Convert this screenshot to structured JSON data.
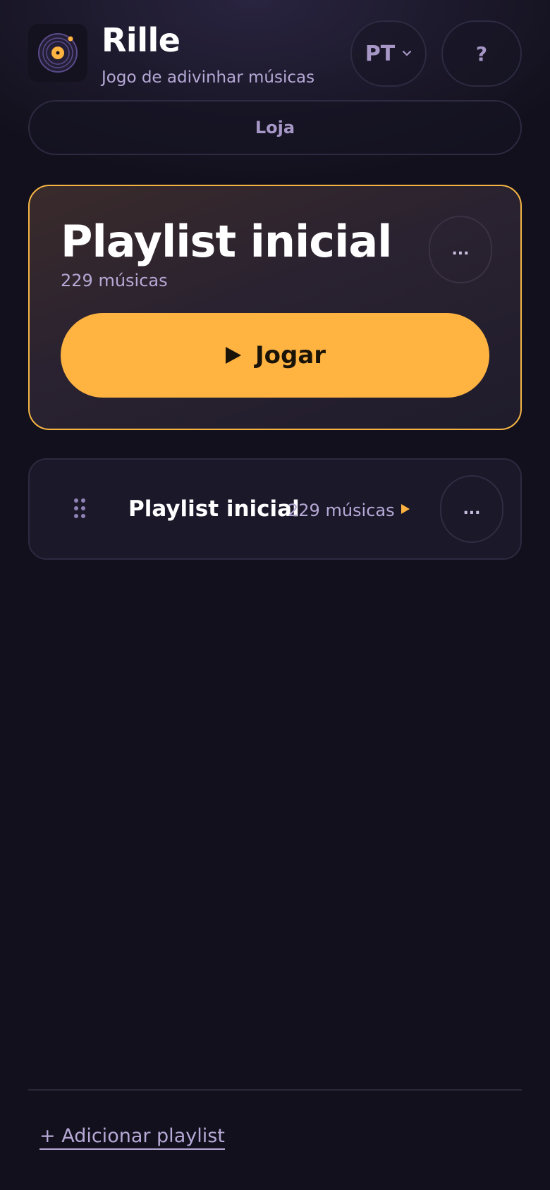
{
  "header": {
    "app_icon": "vinyl-record-icon",
    "title": "Rille",
    "subtitle": "Jogo de adivinhar músicas",
    "language_label": "PT",
    "help_label": "?"
  },
  "shop": {
    "label": "Loja"
  },
  "featured": {
    "title": "Playlist inicial",
    "count": "229 músicas",
    "more_label": "...",
    "play_label": "Jogar"
  },
  "playlists": [
    {
      "title": "Playlist inicial",
      "count": "229 músicas",
      "more_label": "..."
    }
  ],
  "footer": {
    "add_label": "+ Adicionar playlist"
  },
  "colors": {
    "accent": "#ffb341",
    "background": "#12101c",
    "muted_text": "#b6a9d6",
    "card_border": "#2d2a41"
  }
}
